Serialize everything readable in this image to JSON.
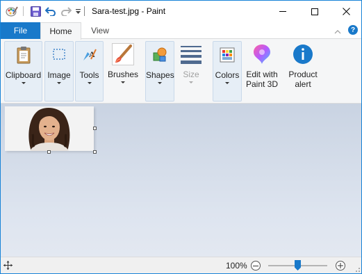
{
  "window": {
    "title": "Sara-test.jpg - Paint",
    "accent": "#1979ca"
  },
  "quick_access": [
    "paint-app-icon",
    "save-icon",
    "undo-icon",
    "redo-icon",
    "customize-qat-icon"
  ],
  "tabs": {
    "file": "File",
    "home": "Home",
    "view": "View"
  },
  "ribbon": {
    "clipboard": "Clipboard",
    "image": "Image",
    "tools": "Tools",
    "brushes": "Brushes",
    "shapes": "Shapes",
    "size": "Size",
    "colors": "Colors",
    "paint3d_line1": "Edit with",
    "paint3d_line2": "Paint 3D",
    "alert_line1": "Product",
    "alert_line2": "alert"
  },
  "canvas": {
    "image_alt": "portrait of a smiling woman with curly dark hair"
  },
  "status": {
    "zoom": "100%",
    "zoom_slider_fraction": 0.5
  }
}
